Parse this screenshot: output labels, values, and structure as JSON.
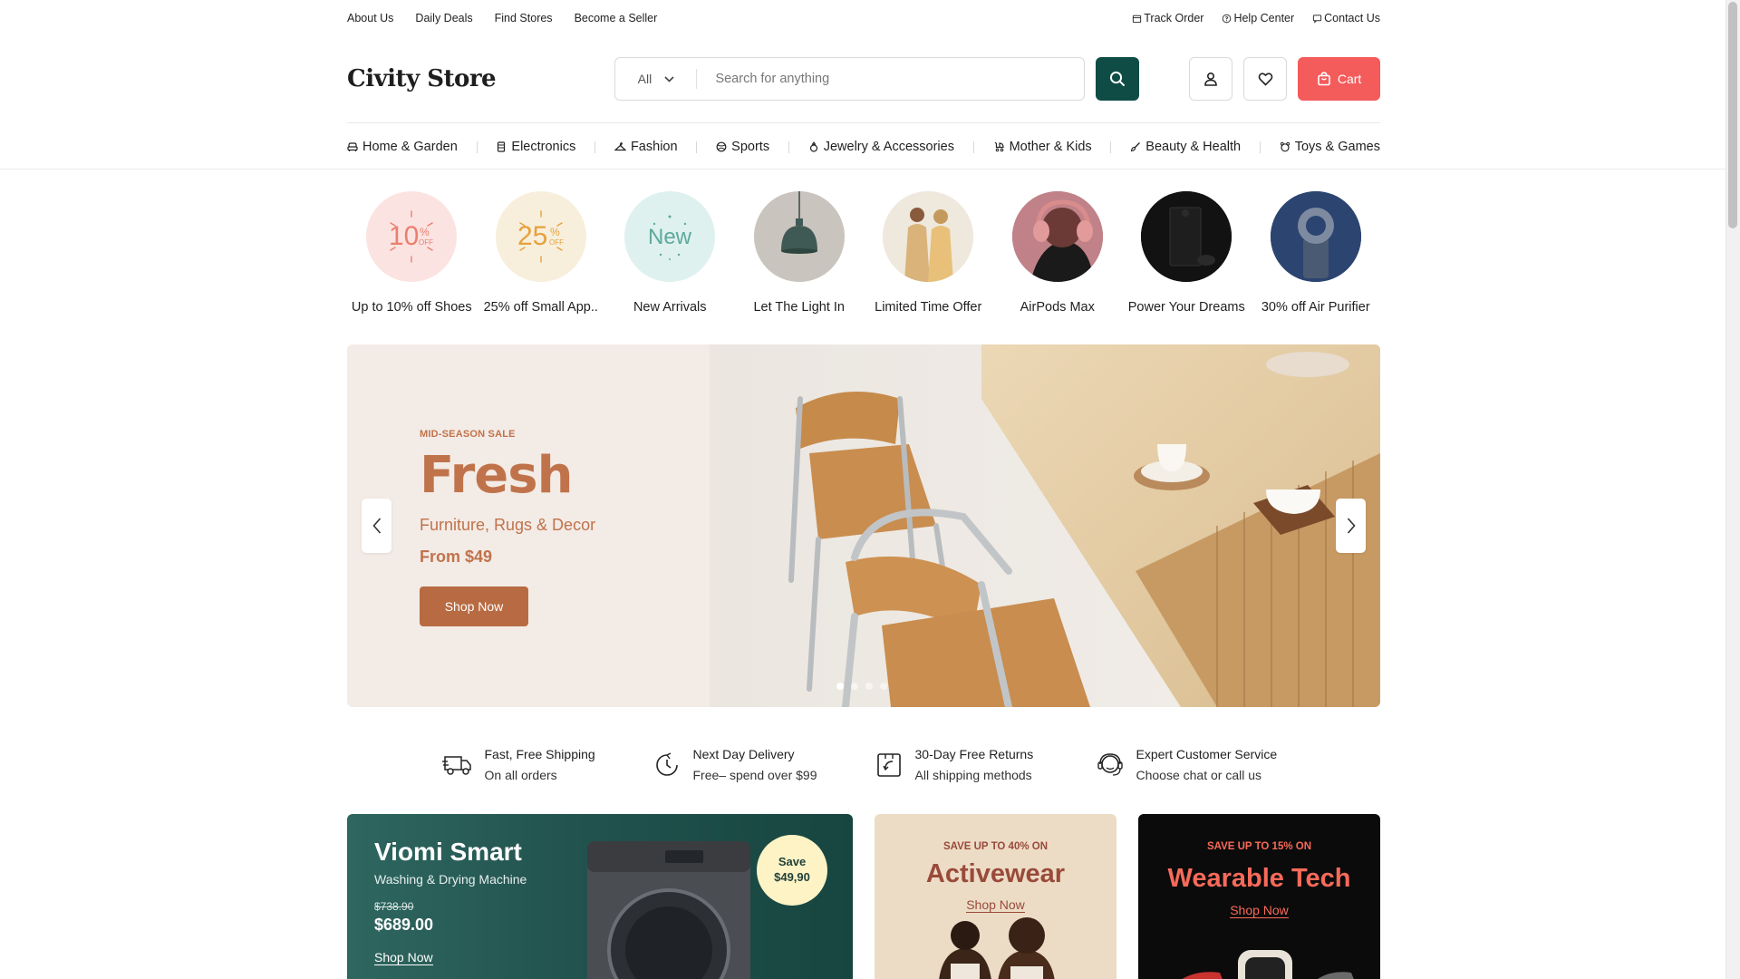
{
  "topbar": {
    "links": [
      "About Us",
      "Daily Deals",
      "Find Stores",
      "Become a Seller"
    ],
    "right": [
      {
        "label": "Track Order",
        "icon": "package-icon"
      },
      {
        "label": "Help Center",
        "icon": "help-circle-icon"
      },
      {
        "label": "Contact Us",
        "icon": "chat-icon"
      }
    ]
  },
  "header": {
    "logo": "Civity Store",
    "category_select": "All",
    "search_placeholder": "Search for anything",
    "cart_label": "Cart"
  },
  "categories": [
    {
      "label": "Home & Garden",
      "icon": "sofa-icon"
    },
    {
      "label": "Electronics",
      "icon": "device-icon"
    },
    {
      "label": "Fashion",
      "icon": "hanger-icon"
    },
    {
      "label": "Sports",
      "icon": "ball-icon"
    },
    {
      "label": "Jewelry & Accessories",
      "icon": "ring-icon"
    },
    {
      "label": "Mother & Kids",
      "icon": "stroller-icon"
    },
    {
      "label": "Beauty & Health",
      "icon": "brush-icon"
    },
    {
      "label": "Toys & Games",
      "icon": "teddy-icon"
    }
  ],
  "stories": [
    {
      "label": "Up to 10% off Shoes",
      "badge_num": "10",
      "badge_pct": "%",
      "badge_off": "OFF",
      "bg": "#fbe3e1",
      "fg": "#e9806f"
    },
    {
      "label": "25% off Small App..",
      "badge_num": "25",
      "badge_pct": "%",
      "badge_off": "OFF",
      "bg": "#f7efdc",
      "fg": "#e6a13d"
    },
    {
      "label": "New Arrivals",
      "badge_num": "New",
      "bg": "#def1ee",
      "fg": "#5fa99c"
    },
    {
      "label": "Let The Light In",
      "image": "pendant-lamp"
    },
    {
      "label": "Limited Time Offer",
      "image": "fashion-models"
    },
    {
      "label": "AirPods Max",
      "image": "headphones-portrait"
    },
    {
      "label": "Power Your Dreams",
      "image": "game-console"
    },
    {
      "label": "30% off Air Purifier",
      "image": "air-purifier"
    }
  ],
  "hero": {
    "eyebrow": "MID-SEASON SALE",
    "title": "Fresh",
    "subtitle": "Furniture, Rugs & Decor",
    "price": "From $49",
    "button": "Shop Now",
    "slide_count": 4,
    "active_slide": 1,
    "accent": "#c0734b"
  },
  "features": [
    {
      "title": "Fast, Free Shipping",
      "subtitle": "On all orders",
      "icon": "truck-icon"
    },
    {
      "title": "Next Day Delivery",
      "subtitle": "Free– spend over $99",
      "icon": "clock-icon"
    },
    {
      "title": "30-Day Free Returns",
      "subtitle": "All shipping methods",
      "icon": "return-icon"
    },
    {
      "title": "Expert Customer Service",
      "subtitle": "Choose chat or call us",
      "icon": "support-icon"
    }
  ],
  "promos": {
    "viomi": {
      "title": "Viomi Smart",
      "subtitle": "Washing & Drying Machine",
      "old_price": "$738.90",
      "new_price": "$689.00",
      "link": "Shop Now",
      "badge_line1": "Save",
      "badge_line2": "$49,90"
    },
    "activewear": {
      "eyebrow": "SAVE UP TO 40% ON",
      "title": "Activewear",
      "link": "Shop Now",
      "accent": "#9a4a3a"
    },
    "wearable": {
      "eyebrow": "SAVE UP TO 15% ON",
      "title": "Wearable Tech",
      "link": "Shop Now",
      "accent": "#f86a5a"
    }
  }
}
